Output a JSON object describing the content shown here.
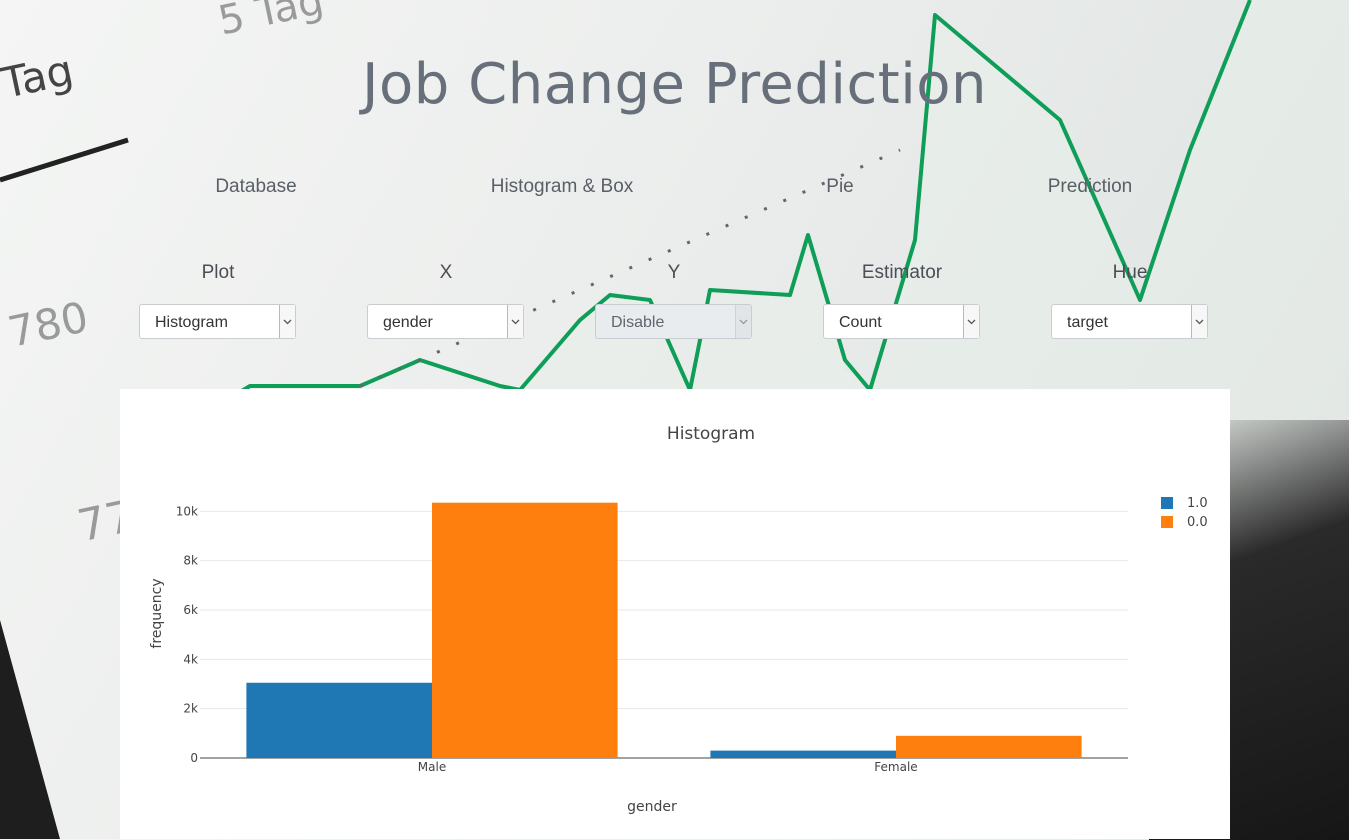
{
  "header": {
    "title": "Job Change Prediction"
  },
  "nav": {
    "tabs": [
      {
        "label": "Database"
      },
      {
        "label": "Histogram & Box"
      },
      {
        "label": "Pie"
      },
      {
        "label": "Prediction"
      }
    ]
  },
  "controls": {
    "plot": {
      "label": "Plot",
      "value": "Histogram",
      "disabled": false
    },
    "x": {
      "label": "X",
      "value": "gender",
      "disabled": false
    },
    "y": {
      "label": "Y",
      "value": "Disable",
      "disabled": true
    },
    "estimator": {
      "label": "Estimator",
      "value": "Count",
      "disabled": false
    },
    "hue": {
      "label": "Hue",
      "value": "target",
      "disabled": false
    }
  },
  "background": {
    "texts": [
      "5 Tag",
      "Tag",
      "780",
      "77"
    ]
  },
  "colors": {
    "series_1": "#1f77b4",
    "series_0": "#ff7f0e",
    "title": "#67707a"
  },
  "chart_data": {
    "type": "bar",
    "title": "Histogram",
    "xlabel": "gender",
    "ylabel": "frequency",
    "categories": [
      "Male",
      "Female"
    ],
    "series": [
      {
        "name": "1.0",
        "values": [
          3050,
          300
        ]
      },
      {
        "name": "0.0",
        "values": [
          10350,
          900
        ]
      }
    ],
    "ylim": [
      0,
      10500
    ],
    "yticks": [
      0,
      2000,
      4000,
      6000,
      8000,
      10000
    ],
    "ytick_labels": [
      "0",
      "2k",
      "4k",
      "6k",
      "8k",
      "10k"
    ],
    "grid": true,
    "legend": "top-right"
  }
}
